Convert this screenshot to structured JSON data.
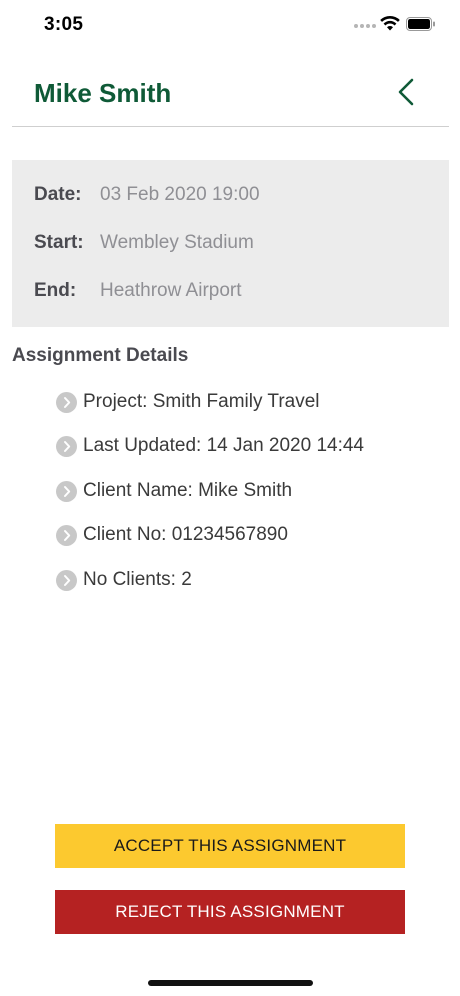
{
  "status_bar": {
    "time": "3:05"
  },
  "header": {
    "title": "Mike Smith"
  },
  "trip": {
    "date_label": "Date:",
    "date_value": "03 Feb 2020 19:00",
    "start_label": "Start:",
    "start_value": "Wembley Stadium",
    "end_label": "End:",
    "end_value": "Heathrow Airport"
  },
  "assignment": {
    "section_title": "Assignment Details",
    "items": [
      "Project: Smith Family Travel",
      "Last Updated: 14 Jan 2020 14:44",
      "Client Name: Mike Smith",
      "Client No: 01234567890",
      "No Clients: 2"
    ]
  },
  "actions": {
    "accept_label": "ACCEPT THIS ASSIGNMENT",
    "reject_label": "REJECT THIS ASSIGNMENT"
  },
  "colors": {
    "title_green": "#0f5a37",
    "accept_yellow": "#fcc92f",
    "reject_red": "#b52222",
    "info_box_bg": "#ececec"
  },
  "icons": [
    "wifi-icon",
    "battery-icon",
    "back-chevron-icon",
    "chevron-right-circle-icon"
  ]
}
